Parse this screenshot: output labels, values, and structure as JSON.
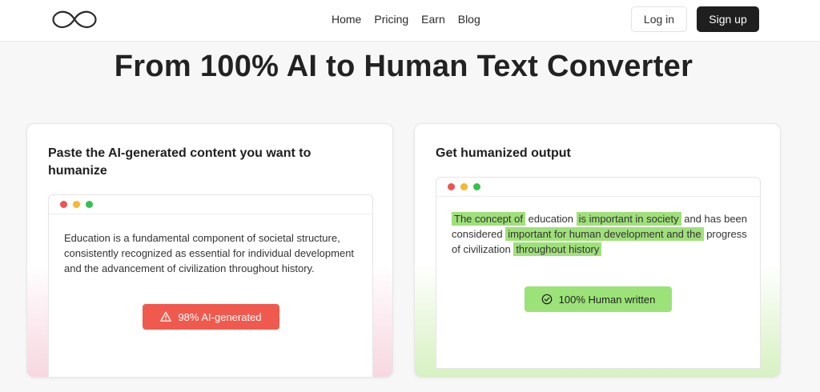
{
  "nav": {
    "logo_icon": "infinity-logo",
    "links": [
      "Home",
      "Pricing",
      "Earn",
      "Blog"
    ],
    "login_label": "Log in",
    "signup_label": "Sign up"
  },
  "hero": {
    "title": "From 100% AI to Human Text Converter"
  },
  "input_card": {
    "title": "Paste the AI-generated content you want to humanize",
    "text": "Education is a fundamental component of societal structure, consistently recognized as essential for individual development and the advancement of civilization throughout history.",
    "badge_icon": "warning-icon",
    "badge_label": "98% AI-generated",
    "badge_color": "#f05a4e"
  },
  "output_card": {
    "title": "Get humanized output",
    "segments": [
      {
        "text": "The concept of",
        "highlight": true
      },
      {
        "text": " education ",
        "highlight": false
      },
      {
        "text": "is important in society",
        "highlight": true
      },
      {
        "text": " and has been considered ",
        "highlight": false
      },
      {
        "text": "important for human development and the",
        "highlight": true
      },
      {
        "text": " progress of civilization ",
        "highlight": false
      },
      {
        "text": "throughout history",
        "highlight": true
      }
    ],
    "badge_icon": "check-circle-icon",
    "badge_label": "100% Human written",
    "badge_color": "#9be279",
    "highlight_color": "#9fe07a"
  },
  "window_dots": [
    "#ef5350",
    "#f5b82e",
    "#33c24d"
  ]
}
